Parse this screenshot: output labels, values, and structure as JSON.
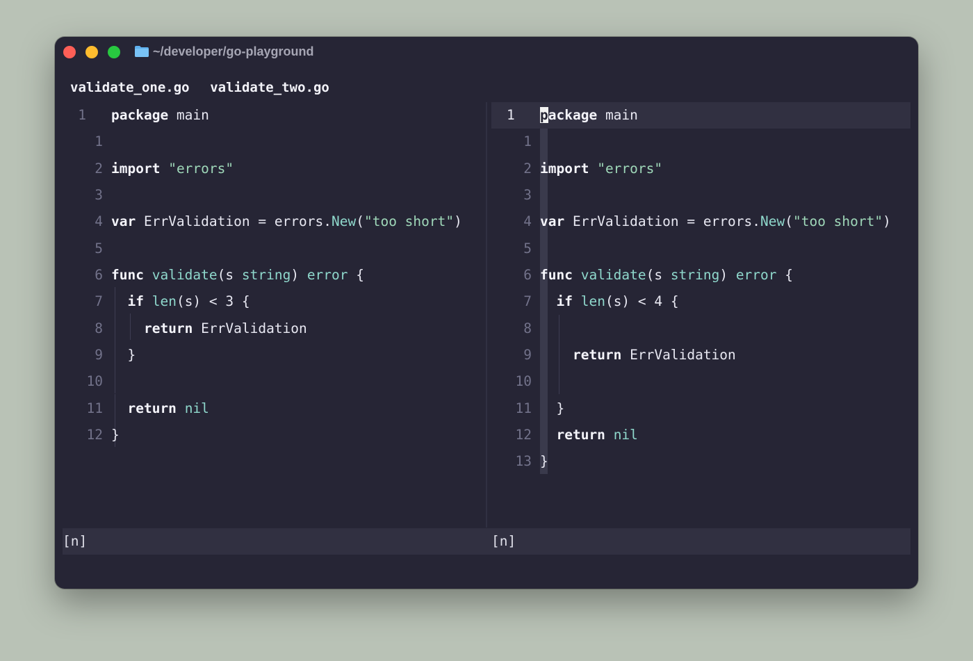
{
  "window": {
    "title": "~/developer/go-playground",
    "traffic_lights": {
      "close": "#fe5f57",
      "minimize": "#febc2e",
      "zoom": "#28c840"
    },
    "folder_icon": "folder-icon"
  },
  "tabs": [
    "validate_one.go",
    "validate_two.go"
  ],
  "left_pane": {
    "file": "validate_one.go",
    "current_line_number": "1",
    "relative_numbers": [
      "1",
      "2",
      "3",
      "4",
      "5",
      "6",
      "7",
      "8",
      "9",
      "10",
      "11",
      "12"
    ],
    "lines": [
      "package main",
      "",
      "import \"errors\"",
      "",
      "var ErrValidation = errors.New(\"too short\")",
      "",
      "func validate(s string) error {",
      "  if len(s) < 3 {",
      "    return ErrValidation",
      "  }",
      "",
      "  return nil",
      "}"
    ],
    "status": "[n]"
  },
  "right_pane": {
    "file": "validate_two.go",
    "current_line_number": "1",
    "relative_numbers": [
      "1",
      "2",
      "3",
      "4",
      "5",
      "6",
      "7",
      "8",
      "9",
      "10",
      "11",
      "12",
      "13"
    ],
    "lines": [
      "package main",
      "",
      "import \"errors\"",
      "",
      "var ErrValidation = errors.New(\"too short\")",
      "",
      "func validate(s string) error {",
      "  if len(s) < 4 {",
      "",
      "    return ErrValidation",
      "",
      "  }",
      "  return nil",
      "}"
    ],
    "status": "[n]"
  },
  "colors": {
    "background": "#262535",
    "keyword": "#f4f4fa",
    "string": "#9fd8b9",
    "function": "#8fd8cc",
    "line_number": "#72728a",
    "current_line": "#313041"
  }
}
